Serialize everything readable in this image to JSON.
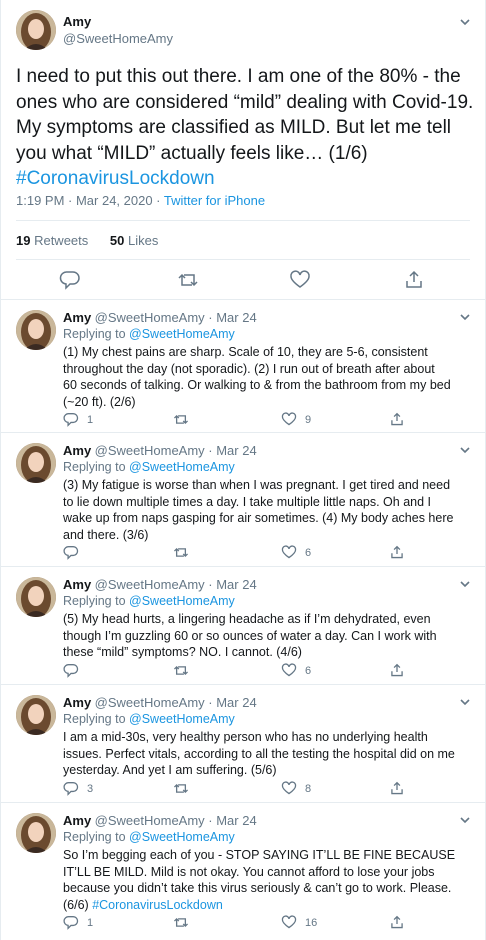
{
  "main_tweet": {
    "name": "Amy",
    "handle": "@SweetHomeAmy",
    "text_lines": [
      "I need to put this out there. I am one of the 80% - the",
      "ones who are considered “mild” dealing with Covid-19.",
      "My symptoms are classified as MILD. But let me tell",
      "you what “MILD” actually feels like… (1/6)"
    ],
    "hashtag": "#CoronavirusLockdown",
    "timestamp": "1:19 PM · Mar 24, 2020 · ",
    "source": "Twitter for iPhone",
    "retweets_count": "19",
    "retweets_label": " Retweets",
    "likes_count": "50",
    "likes_label": " Likes"
  },
  "replies": [
    {
      "name": "Amy",
      "handle_date": "@SweetHomeAmy · Mar 24",
      "replying_label": "Replying to ",
      "replying_to": "@SweetHomeAmy",
      "lines": [
        "(1) My chest pains are sharp. Scale of 10, they are 5-6, consistent",
        "throughout the day (not sporadic).  (2) I run out of breath after about",
        "60 seconds of talking. Or walking to & from the bathroom from my bed",
        "(~20 ft). (2/6)"
      ],
      "hashtag": "",
      "reply_count": "1",
      "retweet_count": "",
      "like_count": "9"
    },
    {
      "name": "Amy",
      "handle_date": "@SweetHomeAmy · Mar 24",
      "replying_label": "Replying to ",
      "replying_to": "@SweetHomeAmy",
      "lines": [
        "(3) My fatigue is worse than when I was pregnant. I get tired and need",
        "to lie down multiple times a day. I take multiple little naps. Oh and I",
        "wake up from naps gasping for air sometimes. (4) My body aches here",
        "and there. (3/6)"
      ],
      "hashtag": "",
      "reply_count": "",
      "retweet_count": "",
      "like_count": "6"
    },
    {
      "name": "Amy",
      "handle_date": "@SweetHomeAmy · Mar 24",
      "replying_label": "Replying to ",
      "replying_to": "@SweetHomeAmy",
      "lines": [
        "(5) My head hurts, a lingering headache as if I’m dehydrated, even",
        "though I’m guzzling 60 or so ounces of water a day. Can I work with",
        "these “mild” symptoms? NO. I cannot. (4/6)"
      ],
      "hashtag": "",
      "reply_count": "",
      "retweet_count": "",
      "like_count": "6"
    },
    {
      "name": "Amy",
      "handle_date": "@SweetHomeAmy · Mar 24",
      "replying_label": "Replying to ",
      "replying_to": "@SweetHomeAmy",
      "lines": [
        "I am a mid-30s, very healthy person who has no underlying health",
        "issues. Perfect vitals, according to all the testing the hospital did on me",
        "yesterday. And yet I am suffering. (5/6)"
      ],
      "hashtag": "",
      "reply_count": "3",
      "retweet_count": "",
      "like_count": "8"
    },
    {
      "name": "Amy",
      "handle_date": "@SweetHomeAmy · Mar 24",
      "replying_label": "Replying to ",
      "replying_to": "@SweetHomeAmy",
      "lines": [
        "So I’m begging each of you - STOP SAYING IT’LL BE FINE BECAUSE",
        "IT’LL BE MILD. Mild is not okay. You cannot afford to lose your jobs",
        "because you didn’t take this virus seriously & can’t go to work. Please.",
        "(6/6) "
      ],
      "hashtag": "#CoronavirusLockdown",
      "reply_count": "1",
      "retweet_count": "",
      "like_count": "16"
    }
  ],
  "icons": {
    "reply": "reply-icon",
    "retweet": "retweet-icon",
    "like": "heart-icon",
    "share": "share-icon",
    "more": "chevron-down-icon"
  },
  "colors": {
    "link": "#1b95e0",
    "muted": "#657786",
    "text": "#14171a",
    "border": "#e6ecf0"
  }
}
